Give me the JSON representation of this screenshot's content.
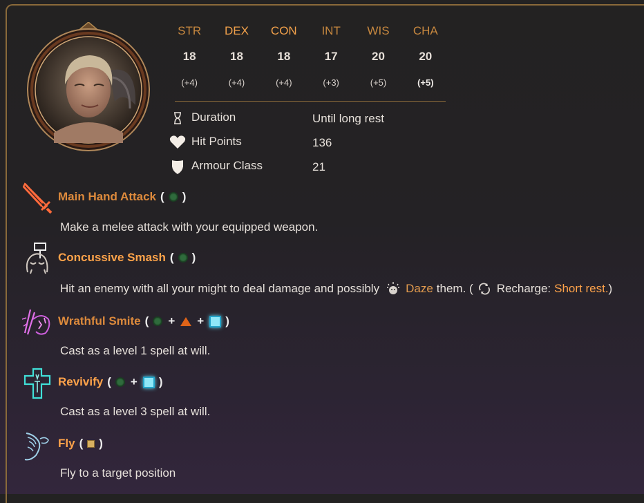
{
  "stats": [
    {
      "name": "STR",
      "value": "18",
      "mod": "(+4)"
    },
    {
      "name": "DEX",
      "value": "18",
      "mod": "(+4)"
    },
    {
      "name": "CON",
      "value": "18",
      "mod": "(+4)"
    },
    {
      "name": "INT",
      "value": "17",
      "mod": "(+3)"
    },
    {
      "name": "WIS",
      "value": "20",
      "mod": "(+5)"
    },
    {
      "name": "CHA",
      "value": "20",
      "mod": "(+5)"
    }
  ],
  "properties": [
    {
      "icon": "hourglass-icon",
      "label": "Duration",
      "value": "Until long rest"
    },
    {
      "icon": "heart-icon",
      "label": "Hit Points",
      "value": "136"
    },
    {
      "icon": "shield-icon",
      "label": "Armour Class",
      "value": "21"
    }
  ],
  "actions": [
    {
      "name": "Main Hand Attack",
      "icon": "sword-icon",
      "resources": [
        "action"
      ],
      "description": "Make a melee attack with your equipped weapon."
    },
    {
      "name": "Concussive Smash",
      "icon": "hammer-strike-icon",
      "resources": [
        "action"
      ],
      "description_prefix": "Hit an enemy with all your might to deal damage and possibly",
      "condition": "Daze",
      "description_mid": "them. (",
      "recharge_label": "Recharge:",
      "recharge_value": "Short rest.",
      "description_suffix": ")"
    },
    {
      "name": "Wrathful Smite",
      "icon": "wrathful-smite-icon",
      "resources": [
        "action",
        "bonus-action",
        "spell-slot"
      ],
      "description": "Cast as a level 1 spell at will."
    },
    {
      "name": "Revivify",
      "icon": "revivify-icon",
      "resources": [
        "action",
        "spell-slot"
      ],
      "description": "Cast as a level 3 spell at will."
    },
    {
      "name": "Fly",
      "icon": "wing-icon",
      "resources": [
        "movement"
      ],
      "description": "Fly to a target position"
    }
  ],
  "colors": {
    "accent": "#c7883f",
    "highlight": "#ffa34a",
    "border": "#8a6a3a"
  }
}
